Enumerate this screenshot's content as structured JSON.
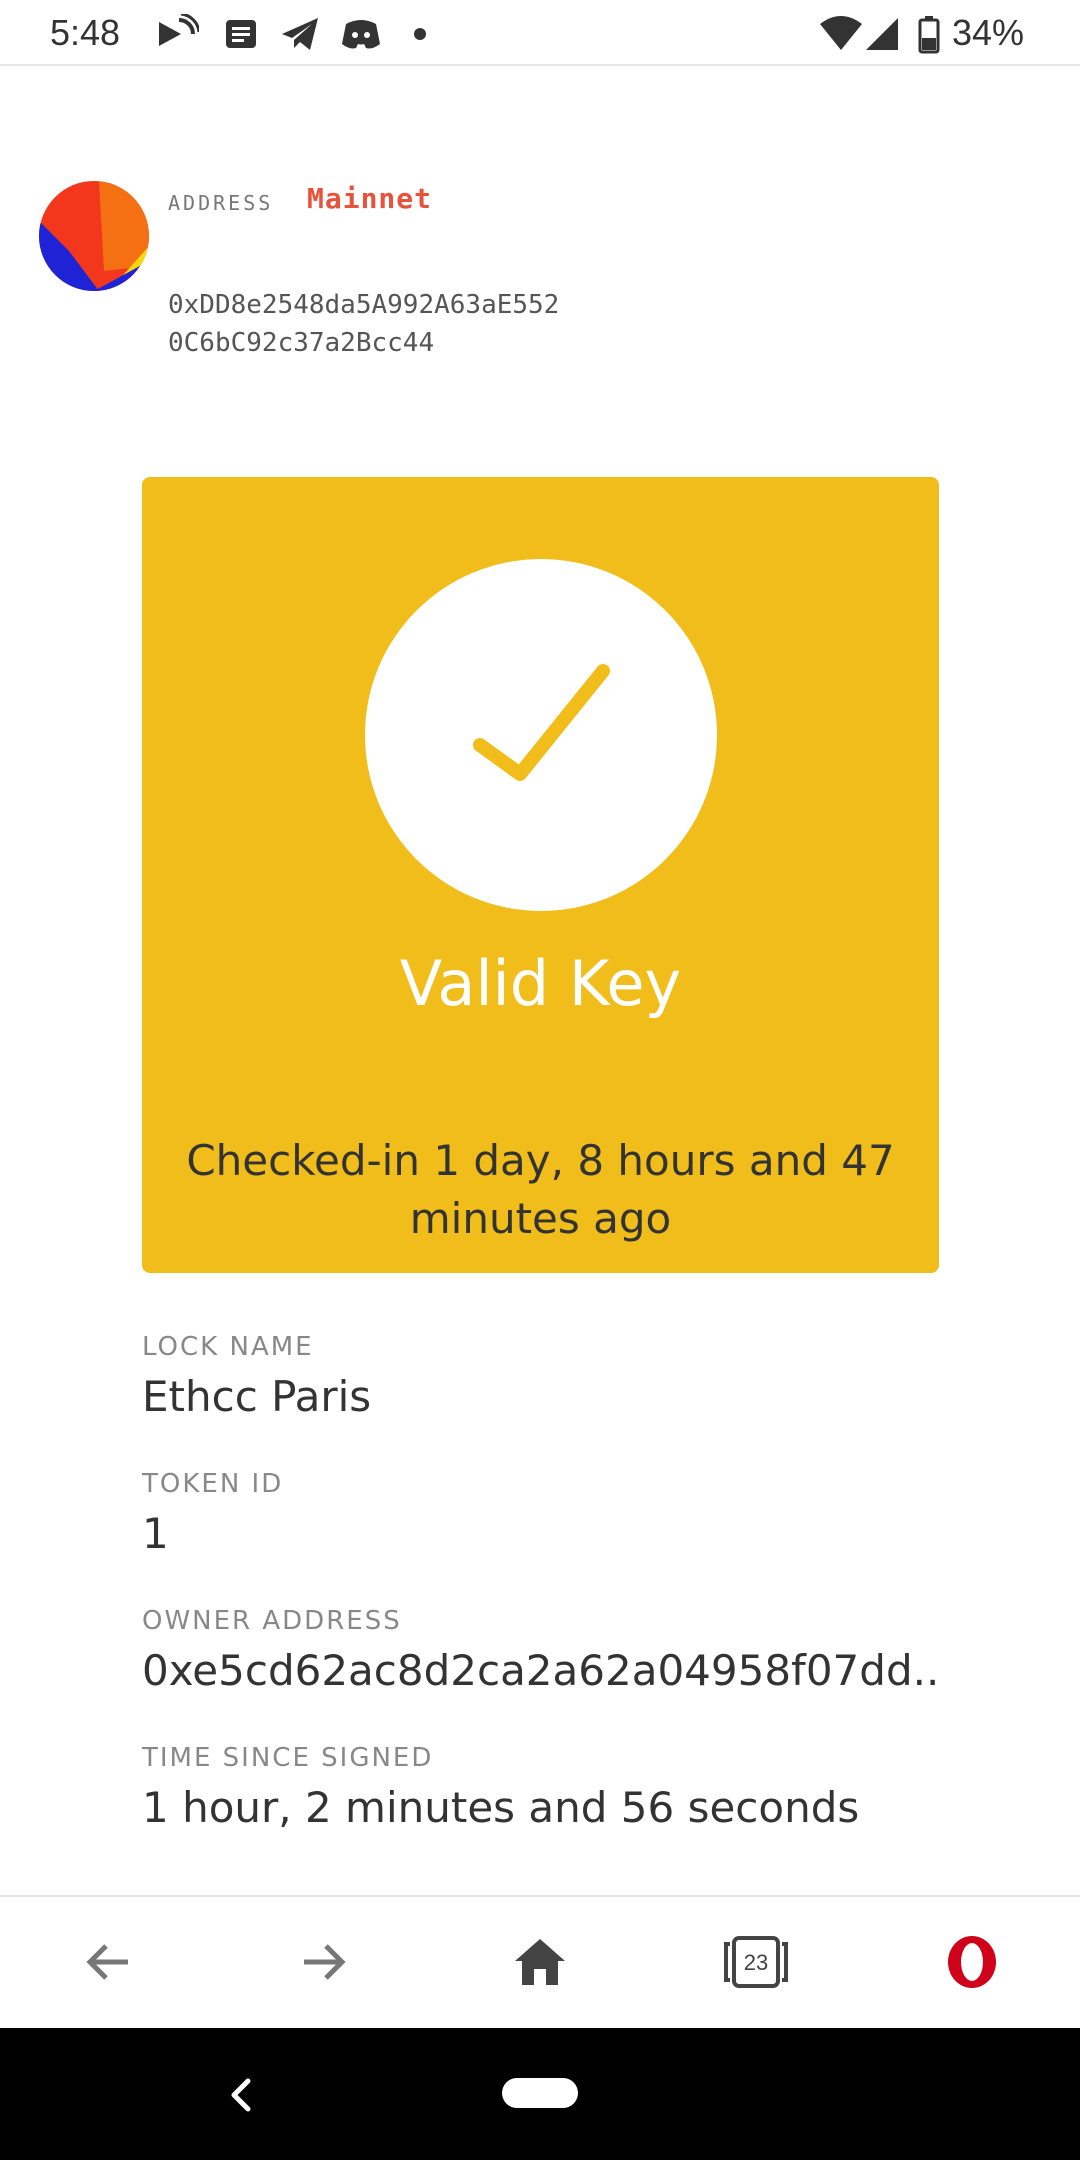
{
  "status_bar": {
    "time": "5:48",
    "battery": "34%",
    "icons": [
      "cast-icon",
      "message-icon",
      "telegram-icon",
      "discord-icon",
      "dot-icon",
      "wifi-icon",
      "signal-icon",
      "battery-icon"
    ]
  },
  "account": {
    "address_label": "ADDRESS",
    "network": "Mainnet",
    "address": "0xDD8e2548da5A992A63aE5520C6bC92c37a2Bcc44"
  },
  "key_card": {
    "status": "Valid Key",
    "checkin": "Checked-in 1 day, 8 hours and 47 minutes ago",
    "background_color": "#f1bd1b"
  },
  "details": {
    "lock_name_label": "LOCK NAME",
    "lock_name": "Ethcc Paris",
    "token_id_label": "TOKEN ID",
    "token_id": "1",
    "owner_address_label": "OWNER ADDRESS",
    "owner_address": "0xe5cd62ac8d2ca2a62a04958f07dd...",
    "time_since_signed_label": "TIME SINCE SIGNED",
    "time_since_signed": "1 hour, 2 minutes and 56 seconds"
  },
  "browser_bar": {
    "tabs_count": "23",
    "icons": [
      "back-arrow-icon",
      "forward-arrow-icon",
      "home-icon",
      "tabs-icon",
      "opera-icon"
    ]
  },
  "colors": {
    "accent": "#f1bd1b",
    "network": "#e8523a",
    "opera": "#d0021b"
  }
}
